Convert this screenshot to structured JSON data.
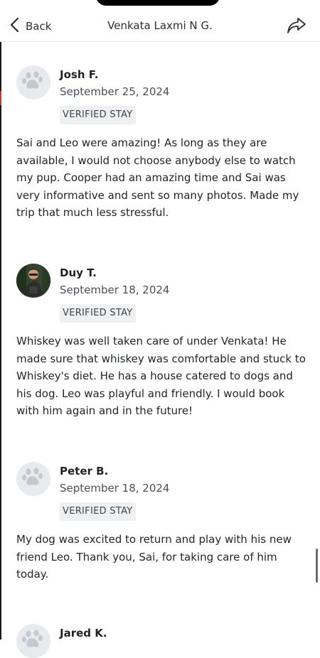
{
  "header": {
    "back_label": "Back",
    "title": "Venkata Laxmi N G.",
    "back_icon": "chevron-left-icon",
    "share_icon": "share-icon"
  },
  "reviews": [
    {
      "name": "Josh F.",
      "date": "September 25, 2024",
      "badge": "VERIFIED STAY",
      "avatar": "paw-icon",
      "text": "Sai and Leo were amazing!  As long as they are available, I would not choose anybody else to watch my pup.  Cooper had an amazing time and Sai was very informative and sent so many photos.  Made my trip that much less stressful."
    },
    {
      "name": "Duy T.",
      "date": "September 18, 2024",
      "badge": "VERIFIED STAY",
      "avatar": "user-photo",
      "text": "Whiskey was well taken care of under Venkata! He made sure that whiskey was comfortable and stuck to Whiskey's diet. He has a house catered to dogs and his dog. Leo was playful and friendly. I would book with him again and in the future!"
    },
    {
      "name": "Peter B.",
      "date": "September 18, 2024",
      "badge": "VERIFIED STAY",
      "avatar": "paw-icon",
      "text": "My dog was excited to return and play with his new friend Leo. Thank you, Sai, for taking care of him today."
    },
    {
      "name": "Jared K.",
      "avatar": "paw-icon"
    }
  ]
}
